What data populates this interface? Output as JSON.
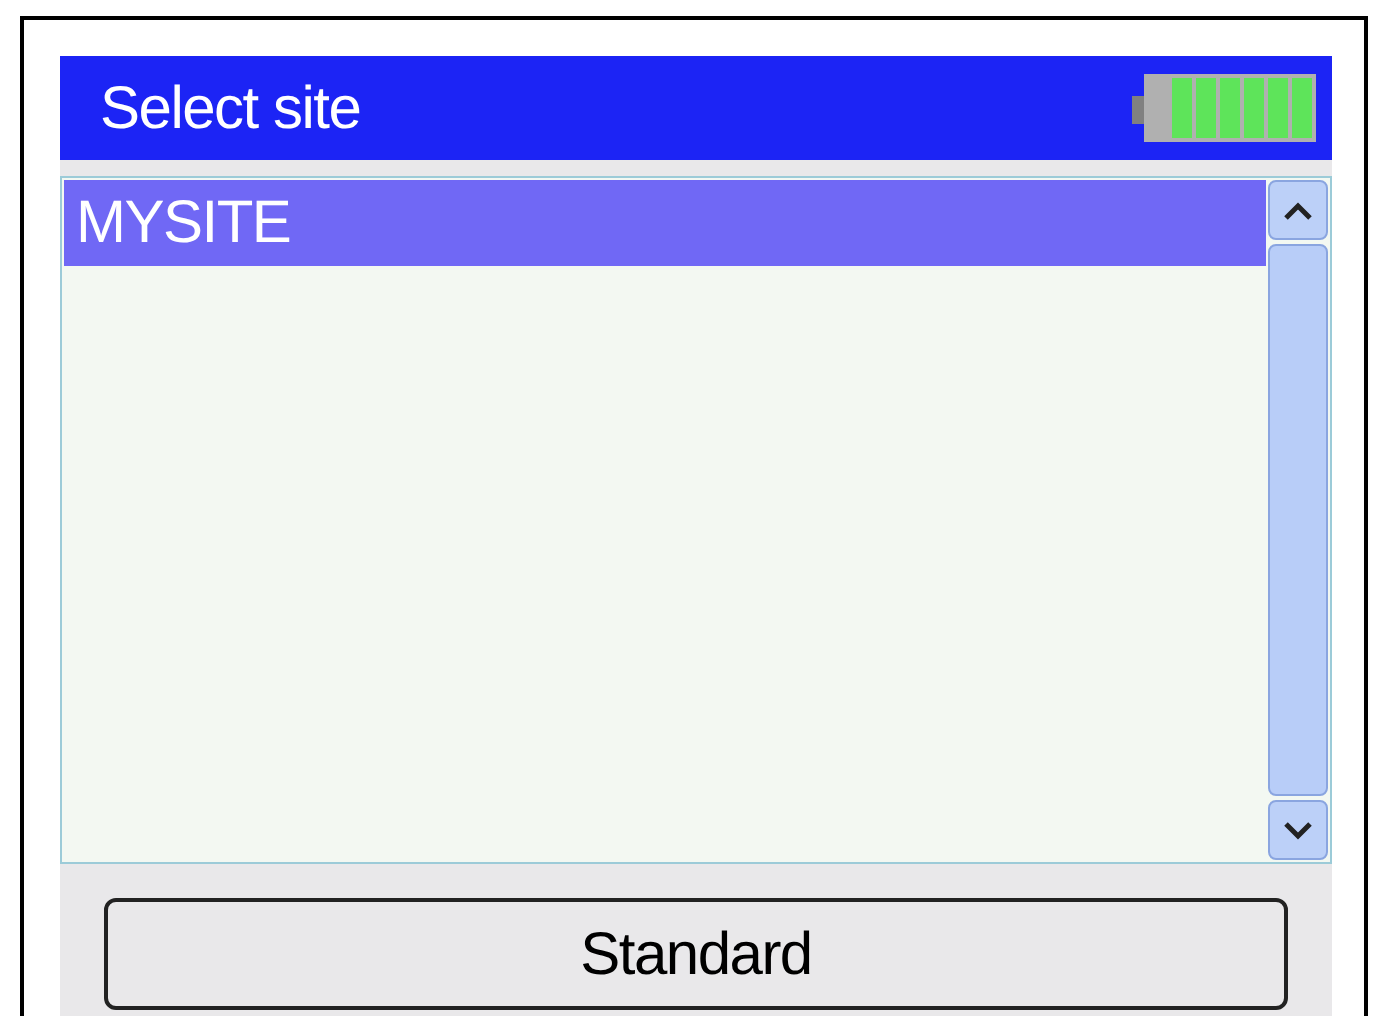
{
  "header": {
    "title": "Select site"
  },
  "sites": [
    {
      "name": "MYSITE",
      "selected": true
    }
  ],
  "button": {
    "label": "Standard"
  }
}
